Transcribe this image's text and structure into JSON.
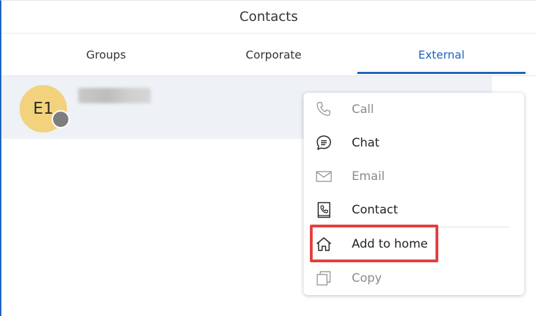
{
  "header": {
    "title": "Contacts"
  },
  "tabs": [
    {
      "label": "Groups",
      "active": false
    },
    {
      "label": "Corporate",
      "active": false
    },
    {
      "label": "External",
      "active": true
    }
  ],
  "contact": {
    "initials": "E1",
    "presence": "offline",
    "avatar_color": "#f2d27c"
  },
  "context_menu": {
    "items": [
      {
        "label": "Call",
        "icon": "phone-icon",
        "enabled": false
      },
      {
        "label": "Chat",
        "icon": "chat-icon",
        "enabled": true
      },
      {
        "label": "Email",
        "icon": "mail-icon",
        "enabled": false
      },
      {
        "label": "Contact",
        "icon": "contact-book-icon",
        "enabled": true
      },
      {
        "label": "Add to home",
        "icon": "home-icon",
        "enabled": true,
        "highlighted": true
      },
      {
        "label": "Copy",
        "icon": "copy-icon",
        "enabled": false
      }
    ]
  },
  "colors": {
    "accent": "#1d63c0",
    "highlight": "#e53e3e",
    "row_background": "#eef1f5",
    "presence_offline": "#7e7e7e"
  }
}
